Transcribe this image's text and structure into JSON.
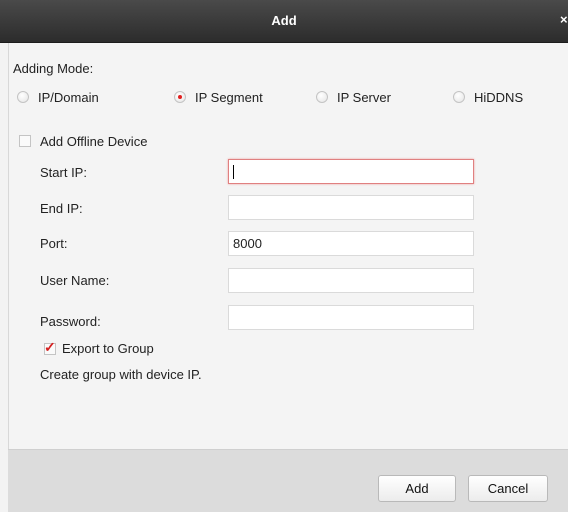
{
  "window": {
    "title": "Add",
    "close_glyph": "×"
  },
  "adding_mode": {
    "label": "Adding Mode:",
    "options": [
      {
        "label": "IP/Domain",
        "checked": false
      },
      {
        "label": "IP Segment",
        "checked": true
      },
      {
        "label": "IP Server",
        "checked": false
      },
      {
        "label": "HiDDNS",
        "checked": false
      }
    ]
  },
  "offline": {
    "label": "Add Offline Device",
    "checked": false
  },
  "fields": {
    "start_ip": {
      "label": "Start IP:",
      "value": ""
    },
    "end_ip": {
      "label": "End IP:",
      "value": ""
    },
    "port": {
      "label": "Port:",
      "value": "8000"
    },
    "user_name": {
      "label": "User Name:",
      "value": ""
    },
    "password": {
      "label": "Password:",
      "value": ""
    }
  },
  "export": {
    "label": "Export to Group",
    "checked": true,
    "checkmark": "✓"
  },
  "note": "Create group with device IP.",
  "buttons": {
    "add": "Add",
    "cancel": "Cancel"
  },
  "colors": {
    "titlebar": "#333333",
    "accent_red": "#e02020",
    "footer": "#dcdcdc"
  }
}
